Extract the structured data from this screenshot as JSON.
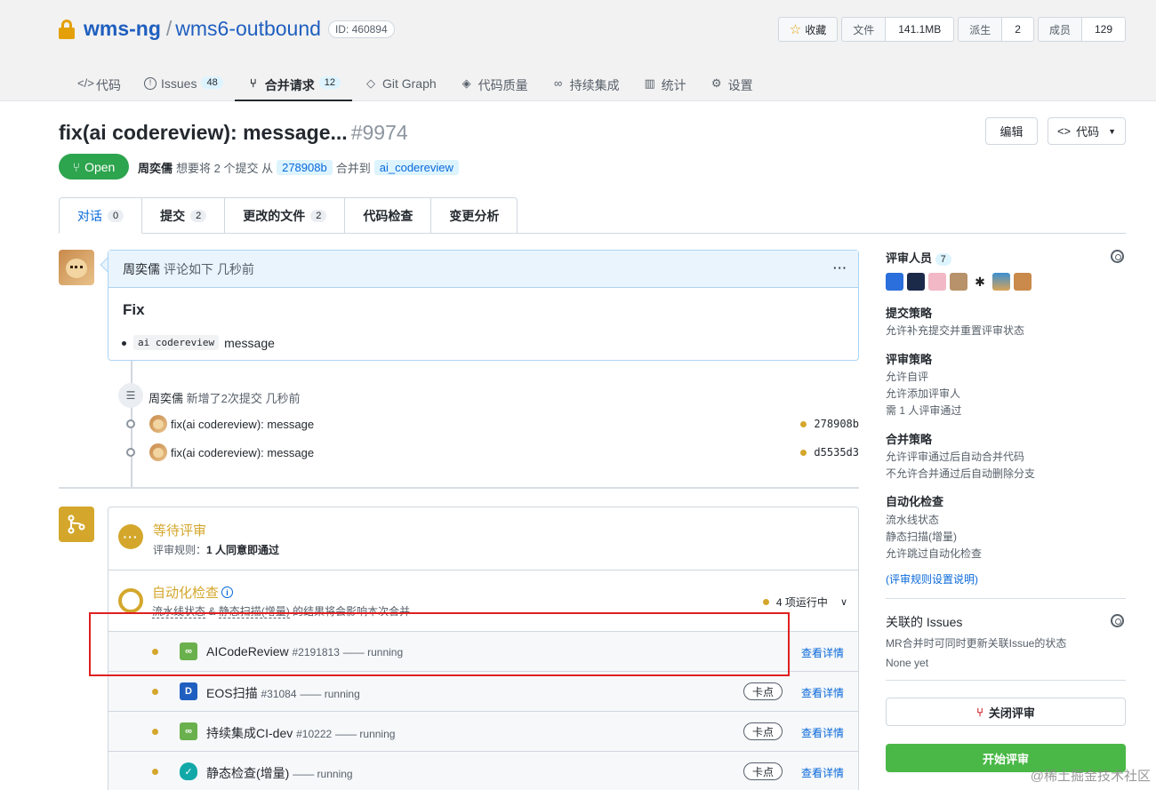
{
  "repo": {
    "owner": "wms-ng",
    "separator": "/",
    "name": "wms6-outbound",
    "id": "ID: 460894"
  },
  "header_buttons": [
    {
      "label": "收藏",
      "count": ""
    },
    {
      "label": "文件",
      "count": "141.1MB"
    },
    {
      "label": "派生",
      "count": "2"
    },
    {
      "label": "成员",
      "count": "129"
    }
  ],
  "nav": [
    {
      "icon": "</>",
      "label": "代码",
      "badge": ""
    },
    {
      "icon": "!",
      "label": "Issues",
      "badge": "48"
    },
    {
      "icon": "⑂",
      "label": "合并请求",
      "badge": "12"
    },
    {
      "icon": "◇",
      "label": "Git Graph",
      "badge": ""
    },
    {
      "icon": "◈",
      "label": "代码质量",
      "badge": ""
    },
    {
      "icon": "∞",
      "label": "持续集成",
      "badge": ""
    },
    {
      "icon": "▥",
      "label": "统计",
      "badge": ""
    },
    {
      "icon": "⚙",
      "label": "设置",
      "badge": ""
    }
  ],
  "pr": {
    "title": "fix(ai codereview): message...",
    "number": "#9974",
    "status": "Open",
    "author": "周奕儒",
    "meta_1": "想要将 2 个提交 从",
    "source_branch": "278908b",
    "meta_2": "合并到",
    "target_branch": "ai_codereview",
    "edit_label": "编辑",
    "code_label": "代码"
  },
  "tabs": [
    {
      "label": "对话",
      "badge": "0"
    },
    {
      "label": "提交",
      "badge": "2"
    },
    {
      "label": "更改的文件",
      "badge": "2"
    },
    {
      "label": "代码检查",
      "badge": ""
    },
    {
      "label": "变更分析",
      "badge": ""
    }
  ],
  "comment": {
    "author": "周奕儒",
    "action": "评论如下 几秒前",
    "menu": "···",
    "heading": "Fix",
    "item_code": "ai codereview",
    "item_text": "message"
  },
  "push_event": {
    "author": "周奕儒",
    "text": "新增了2次提交 几秒前"
  },
  "commits": [
    {
      "message": "fix(ai codereview): message",
      "sha": "278908b"
    },
    {
      "message": "fix(ai codereview): message",
      "sha": "d5535d3"
    }
  ],
  "merge": {
    "wait_title": "等待评审",
    "wait_rule_label": "评审规则：",
    "wait_rule_value": "1 人同意即通过",
    "auto_title": "自动化检查",
    "auto_sub_1": "流水线状态",
    "auto_sub_amp": "&",
    "auto_sub_2": "静态扫描(增量)",
    "auto_sub_3": "的结果将会影响本次合并",
    "running_status": "4 项运行中",
    "checks": [
      {
        "name": "AICodeReview",
        "id": "#2191813",
        "status": "—— running",
        "tag": "",
        "detail": "查看详情",
        "color": "#6ab04c",
        "icon": "∞"
      },
      {
        "name": "EOS扫描",
        "id": "#31084",
        "status": "—— running",
        "tag": "卡点",
        "detail": "查看详情",
        "color": "#1f5fbf",
        "icon": "D"
      },
      {
        "name": "持续集成CI-dev",
        "id": "#10222",
        "status": "—— running",
        "tag": "卡点",
        "detail": "查看详情",
        "color": "#6ab04c",
        "icon": "∞"
      },
      {
        "name": "静态检查(增量)",
        "id": "",
        "status": "—— running",
        "tag": "卡点",
        "detail": "查看详情",
        "color": "#12a8a8",
        "icon": "✓"
      }
    ]
  },
  "sidebar": {
    "reviewers_title": "评审人员",
    "reviewers_count": "7",
    "reviewer_colors": [
      "#2a6fdb",
      "#1c2a4a",
      "#f2b8c6",
      "#b8926a",
      "#222222",
      "#3b8fd1",
      "#c98a4b"
    ],
    "submit_policy_title": "提交策略",
    "submit_policy": [
      "允许补充提交并重置评审状态"
    ],
    "review_policy_title": "评审策略",
    "review_policy": [
      "允许自评",
      "允许添加评审人",
      "需 1 人评审通过"
    ],
    "merge_policy_title": "合并策略",
    "merge_policy": [
      "允许评审通过后自动合并代码",
      "不允许合并通过后自动删除分支"
    ],
    "auto_check_title": "自动化检查",
    "auto_check": [
      "流水线状态",
      "静态扫描(增量)",
      "允许跳过自动化检查"
    ],
    "rules_link": "(评审规则设置说明)",
    "issues_title": "关联的 Issues",
    "issues_desc": "MR合并时可同时更新关联Issue的状态",
    "issues_none": "None yet",
    "close_label": "关闭评审",
    "start_label": "开始评审"
  },
  "watermark": "@稀土掘金技术社区"
}
